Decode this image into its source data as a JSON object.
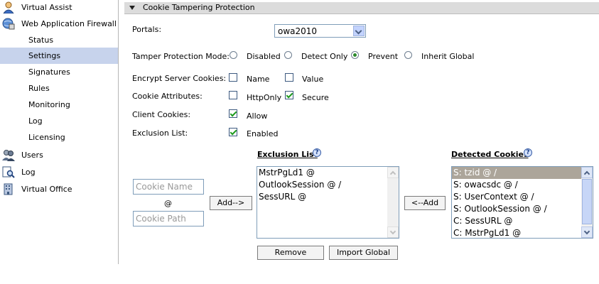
{
  "sidebar": {
    "items": [
      {
        "label": "Virtual Assist",
        "icon": "user-headset-icon"
      },
      {
        "label": "Web Application Firewall",
        "icon": "globe-firewall-icon"
      },
      {
        "label": "Status"
      },
      {
        "label": "Settings"
      },
      {
        "label": "Signatures"
      },
      {
        "label": "Rules"
      },
      {
        "label": "Monitoring"
      },
      {
        "label": "Log"
      },
      {
        "label": "Licensing"
      },
      {
        "label": "Users",
        "icon": "users-icon"
      },
      {
        "label": "Log",
        "icon": "log-search-icon"
      },
      {
        "label": "Virtual Office",
        "icon": "building-icon"
      }
    ]
  },
  "section": {
    "title": "Cookie Tampering Protection"
  },
  "form": {
    "portals": {
      "label": "Portals:",
      "value": "owa2010"
    },
    "tamper_mode": {
      "label": "Tamper Protection Mode:",
      "options": [
        "Disabled",
        "Detect Only",
        "Prevent",
        "Inherit Global"
      ],
      "selected": "Prevent"
    },
    "encrypt": {
      "label": "Encrypt Server Cookies:",
      "name": "Name",
      "value": "Value"
    },
    "attributes": {
      "label": "Cookie Attributes:",
      "httponly": "HttpOnly",
      "secure": "Secure"
    },
    "client_cookies": {
      "label": "Client Cookies:",
      "allow": "Allow"
    },
    "exclusion": {
      "label": "Exclusion List:",
      "enabled": "Enabled"
    }
  },
  "exclusion_list": {
    "heading": "Exclusion List",
    "items": [
      "MstrPgLd1 @",
      "OutlookSession @ /",
      "SessURL @"
    ]
  },
  "detected": {
    "heading": "Detected Cookies",
    "items": [
      "S: tzid @ /",
      "S: owacsdc @ /",
      "S: UserContext @ /",
      "S: OutlookSession @ /",
      "C: SessURL @",
      "C: MstrPgLd1 @"
    ]
  },
  "inputs": {
    "cookie_name_placeholder": "Cookie Name",
    "at": "@",
    "cookie_path_placeholder": "Cookie Path"
  },
  "buttons": {
    "add": "Add-->",
    "add_back": "<--Add",
    "remove": "Remove",
    "import_global": "Import Global"
  }
}
